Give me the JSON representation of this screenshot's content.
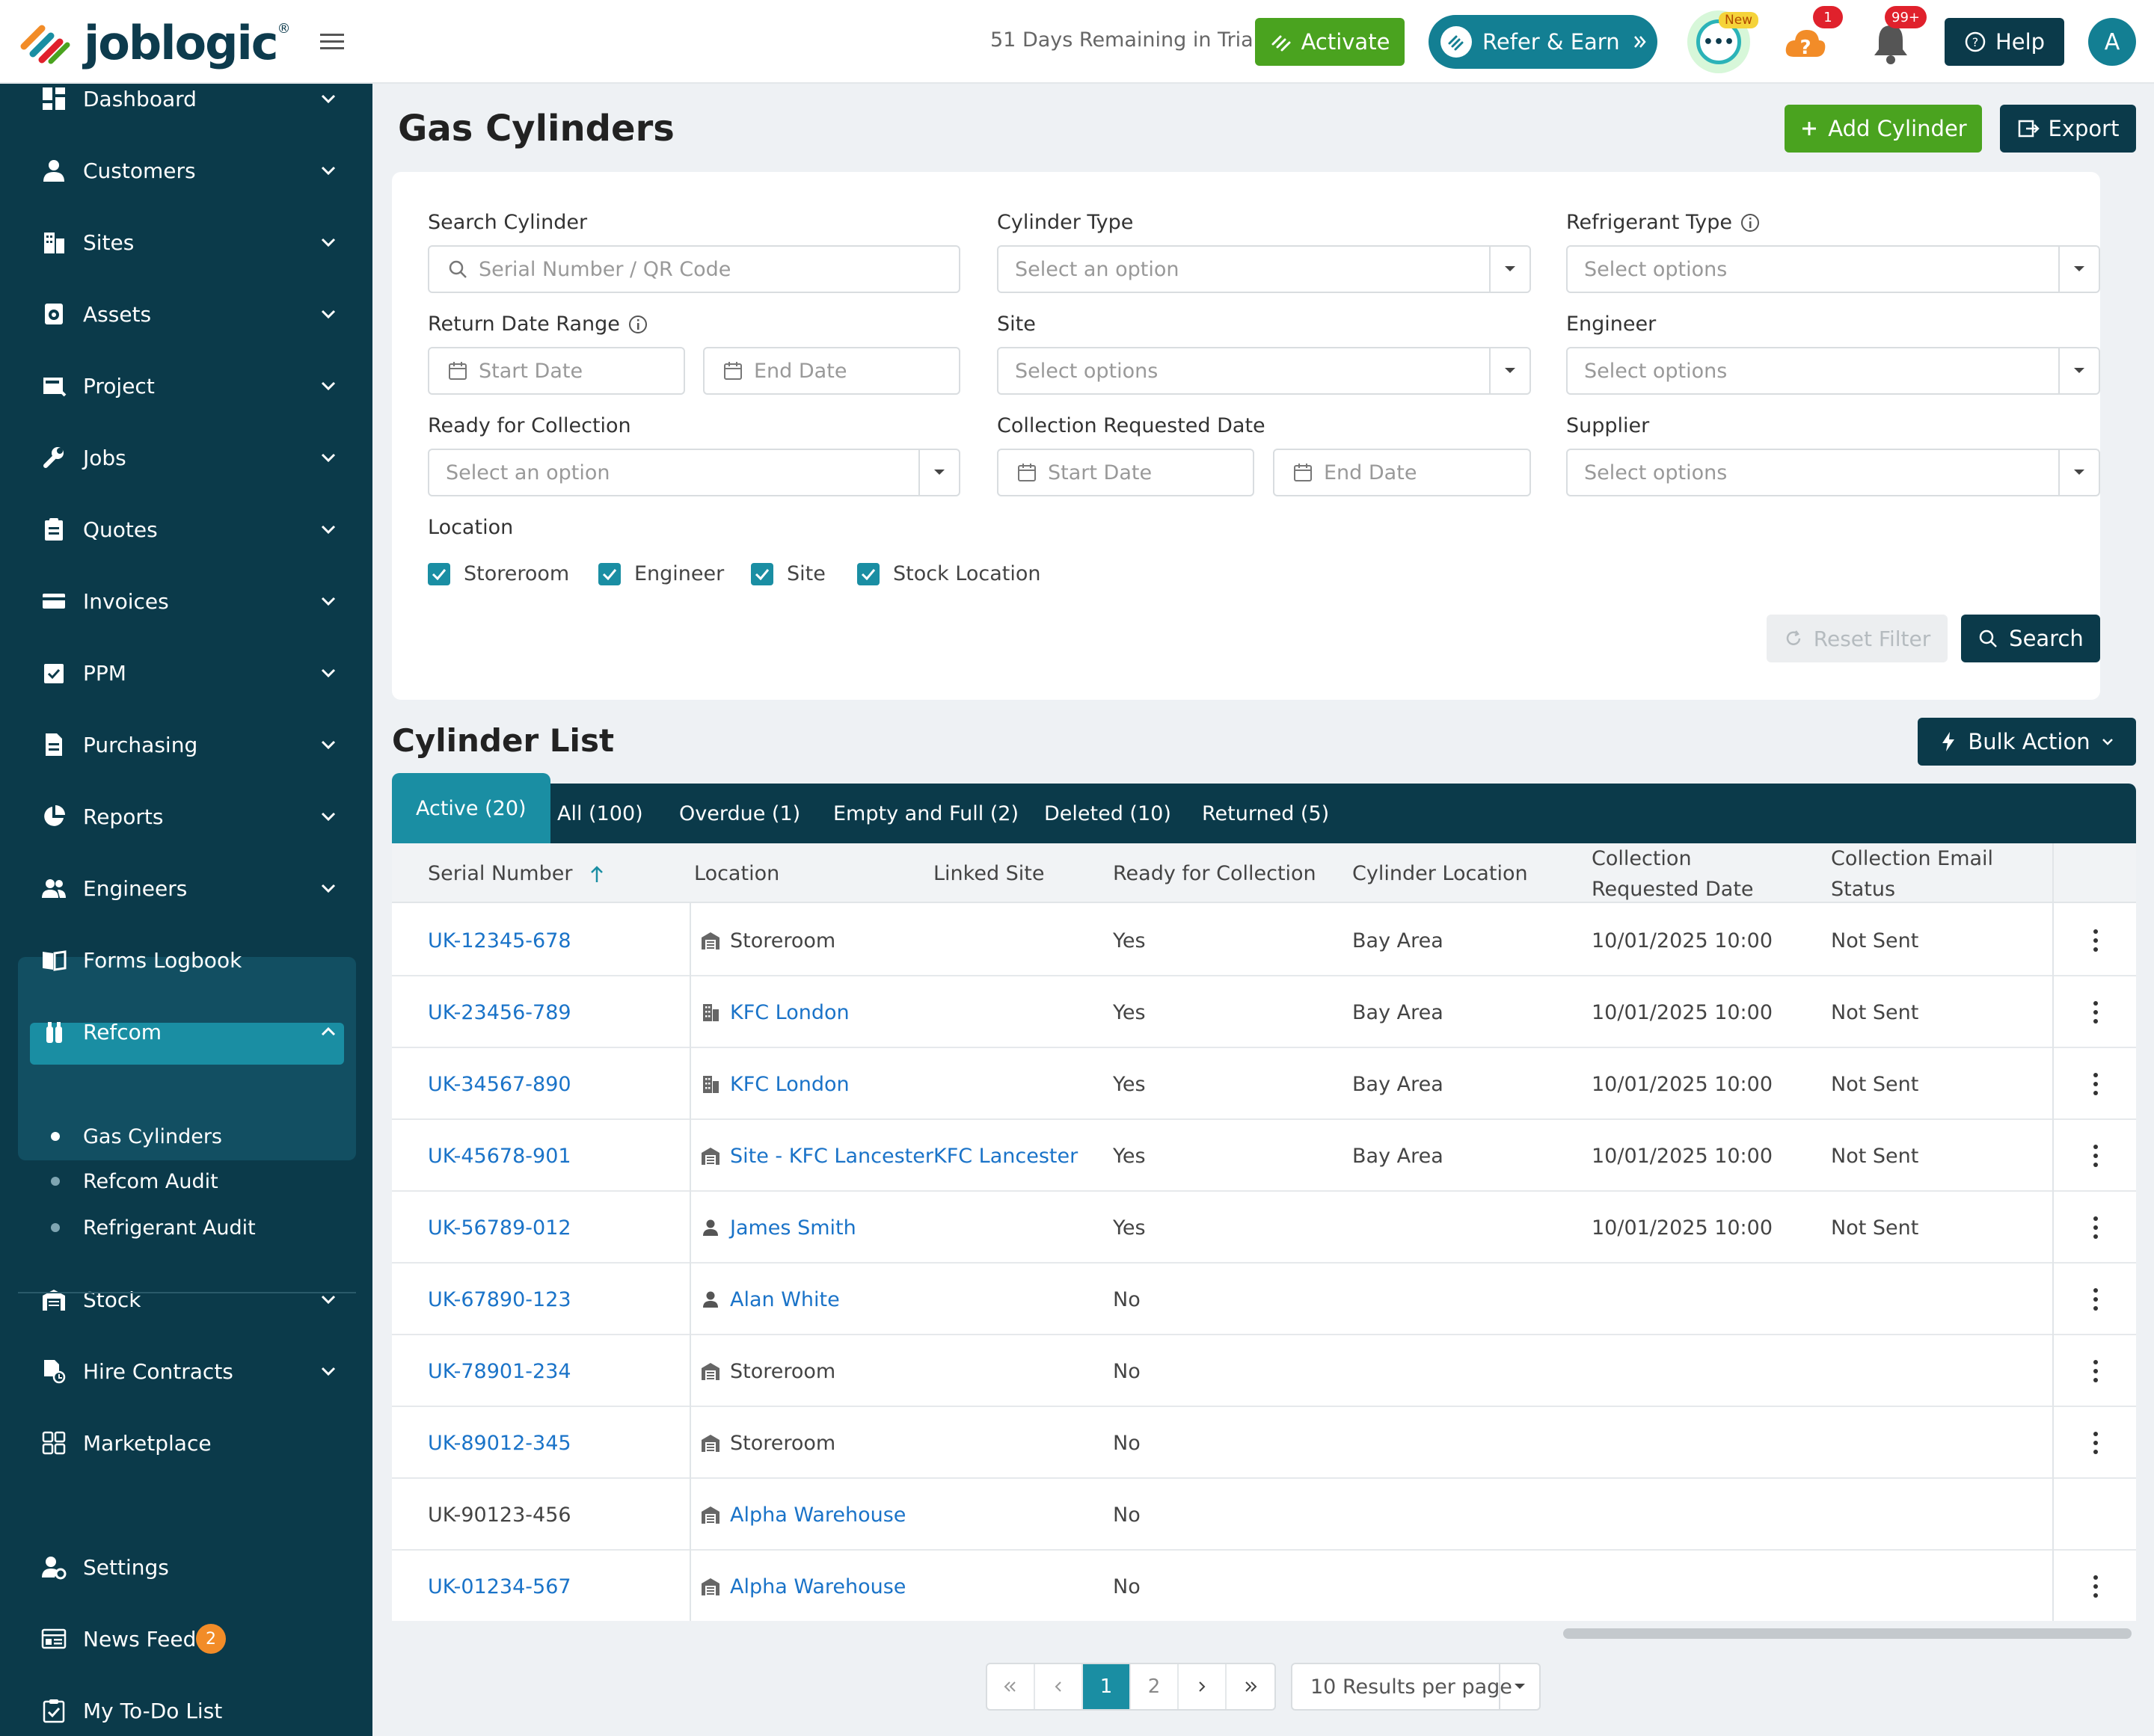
{
  "topbar": {
    "logo_text": "joblogic",
    "logo_reg": "®",
    "trial_text": "51 Days Remaining in Trial",
    "activate_label": "Activate",
    "refer_label": "Refer & Earn",
    "new_badge": "New",
    "help_count": "1",
    "notifications_count": "99+",
    "help_label": "Help",
    "avatar_initial": "A"
  },
  "sidebar": {
    "items": [
      {
        "label": "Dashboard"
      },
      {
        "label": "Customers"
      },
      {
        "label": "Sites"
      },
      {
        "label": "Assets"
      },
      {
        "label": "Project"
      },
      {
        "label": "Jobs"
      },
      {
        "label": "Quotes"
      },
      {
        "label": "Invoices"
      },
      {
        "label": "PPM"
      },
      {
        "label": "Purchasing"
      },
      {
        "label": "Reports"
      },
      {
        "label": "Engineers"
      },
      {
        "label": "Forms Logbook"
      },
      {
        "label": "Refcom"
      }
    ],
    "refcom_sub": [
      {
        "label": "Gas Cylinders"
      },
      {
        "label": "Refcom Audit"
      },
      {
        "label": "Refrigerant Audit"
      }
    ],
    "items_after": [
      {
        "label": "Stock"
      },
      {
        "label": "Hire Contracts"
      },
      {
        "label": "Marketplace"
      }
    ],
    "bottom": [
      {
        "label": "Settings"
      },
      {
        "label": "News Feed"
      },
      {
        "label": "My To-Do List"
      }
    ],
    "news_badge": "2",
    "live_chat": "Live Chat"
  },
  "page": {
    "title": "Gas Cylinders",
    "add_cylinder": "Add Cylinder",
    "export": "Export"
  },
  "filters": {
    "search_cylinder_label": "Search Cylinder",
    "search_cylinder_placeholder": "Serial Number / QR Code",
    "cylinder_type_label": "Cylinder Type",
    "cylinder_type_placeholder": "Select an option",
    "refrigerant_type_label": "Refrigerant Type",
    "refrigerant_type_placeholder": "Select options",
    "return_date_label": "Return Date Range",
    "start_date": "Start Date",
    "end_date": "End Date",
    "site_label": "Site",
    "site_placeholder": "Select options",
    "engineer_label": "Engineer",
    "engineer_placeholder": "Select options",
    "ready_label": "Ready for Collection",
    "ready_placeholder": "Select an option",
    "collection_req_label": "Collection Requested Date",
    "supplier_label": "Supplier",
    "supplier_placeholder": "Select options",
    "location_label": "Location",
    "location_options": [
      "Storeroom",
      "Engineer",
      "Site",
      "Stock Location"
    ],
    "reset_label": "Reset Filter",
    "search_label": "Search"
  },
  "list": {
    "title": "Cylinder List",
    "bulk_action": "Bulk Action",
    "tabs": [
      "Active (20)",
      "All (100)",
      "Overdue (1)",
      "Empty and Full (2)",
      "Deleted (10)",
      "Returned (5)"
    ],
    "columns": {
      "serial": "Serial Number",
      "location": "Location",
      "linked_site": "Linked Site",
      "ready": "Ready for Collection",
      "cyl_location": "Cylinder Location",
      "coll_req_1": "Collection",
      "coll_req_2": "Requested Date",
      "coll_email_1": "Collection Email",
      "coll_email_2": "Status"
    },
    "rows": [
      {
        "serial": "UK-12345-678",
        "location": "Storeroom",
        "loc_icon": "storeroom-icon",
        "loc_link": false,
        "linked_site": "",
        "ready": "Yes",
        "cyl_location": "Bay Area",
        "coll_date": "10/01/2025 10:00",
        "email_status": "Not Sent"
      },
      {
        "serial": "UK-23456-789",
        "location": "KFC London",
        "loc_icon": "building-icon",
        "loc_link": true,
        "linked_site": "",
        "ready": "Yes",
        "cyl_location": "Bay Area",
        "coll_date": "10/01/2025 10:00",
        "email_status": "Not Sent"
      },
      {
        "serial": "UK-34567-890",
        "location": "KFC London",
        "loc_icon": "building-icon",
        "loc_link": true,
        "linked_site": "",
        "ready": "Yes",
        "cyl_location": "Bay Area",
        "coll_date": "10/01/2025 10:00",
        "email_status": "Not Sent"
      },
      {
        "serial": "UK-45678-901",
        "location": "Site - KFC Lancester",
        "loc_icon": "storeroom-icon",
        "loc_link": true,
        "linked_site": "KFC Lancester",
        "ready": "Yes",
        "cyl_location": "Bay Area",
        "coll_date": "10/01/2025 10:00",
        "email_status": "Not Sent"
      },
      {
        "serial": "UK-56789-012",
        "location": "James Smith",
        "loc_icon": "person-icon",
        "loc_link": true,
        "linked_site": "",
        "ready": "Yes",
        "cyl_location": "",
        "coll_date": "10/01/2025 10:00",
        "email_status": "Not Sent"
      },
      {
        "serial": "UK-67890-123",
        "location": "Alan White",
        "loc_icon": "person-icon",
        "loc_link": true,
        "linked_site": "",
        "ready": "No",
        "cyl_location": "",
        "coll_date": "",
        "email_status": ""
      },
      {
        "serial": "UK-78901-234",
        "location": "Storeroom",
        "loc_icon": "storeroom-icon",
        "loc_link": false,
        "linked_site": "",
        "ready": "No",
        "cyl_location": "",
        "coll_date": "",
        "email_status": ""
      },
      {
        "serial": "UK-89012-345",
        "location": "Storeroom",
        "loc_icon": "storeroom-icon",
        "loc_link": false,
        "linked_site": "",
        "ready": "No",
        "cyl_location": "",
        "coll_date": "",
        "email_status": ""
      },
      {
        "serial": "UK-90123-456",
        "location": "Alpha Warehouse",
        "loc_icon": "storeroom-icon",
        "loc_link": true,
        "linked_site": "",
        "ready": "No",
        "cyl_location": "",
        "coll_date": "",
        "email_status": ""
      },
      {
        "serial": "UK-01234-567",
        "location": "Alpha Warehouse",
        "loc_icon": "storeroom-icon",
        "loc_link": true,
        "linked_site": "",
        "ready": "No",
        "cyl_location": "",
        "coll_date": "",
        "email_status": ""
      }
    ]
  },
  "pagination": {
    "pages": [
      "1",
      "2"
    ],
    "current": "1",
    "per_page": "10 Results per page"
  },
  "colors": {
    "primary_dark": "#0b3a4a",
    "accent": "#1a8ea3",
    "green": "#4aa31f",
    "link": "#1a73c8"
  }
}
